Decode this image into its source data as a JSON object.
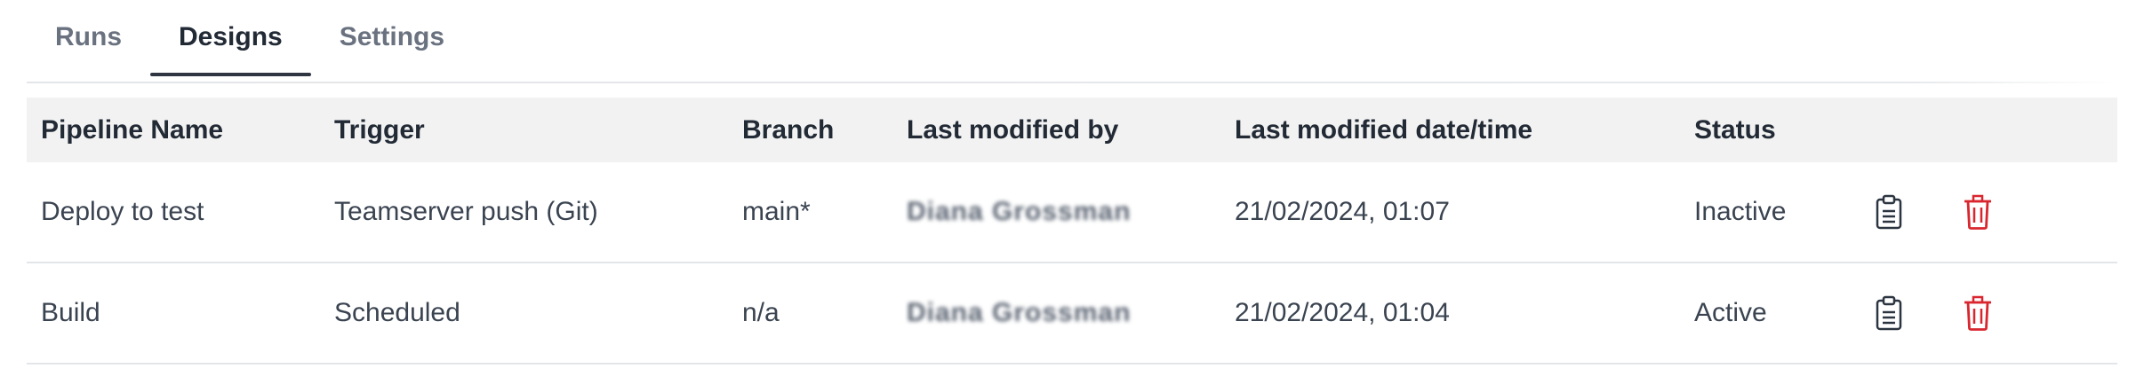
{
  "tabs": [
    {
      "label": "Runs",
      "active": false
    },
    {
      "label": "Designs",
      "active": true
    },
    {
      "label": "Settings",
      "active": false
    }
  ],
  "table": {
    "headers": [
      "Pipeline Name",
      "Trigger",
      "Branch",
      "Last modified by",
      "Last modified date/time",
      "Status"
    ],
    "rows": [
      {
        "name": "Deploy to test",
        "trigger": "Teamserver push (Git)",
        "branch": "main*",
        "modified_by": "Diana Grossman",
        "modified_at": "21/02/2024, 01:07",
        "status": "Inactive"
      },
      {
        "name": "Build",
        "trigger": "Scheduled",
        "branch": "n/a",
        "modified_by": "Diana Grossman",
        "modified_at": "21/02/2024, 01:04",
        "status": "Active"
      }
    ],
    "actions": {
      "copy_icon": "clipboard-icon",
      "delete_icon": "trash-icon"
    }
  },
  "colors": {
    "delete": "#d9262e",
    "header_bg": "#f2f2f2",
    "tab_active_underline": "#2f3642"
  }
}
